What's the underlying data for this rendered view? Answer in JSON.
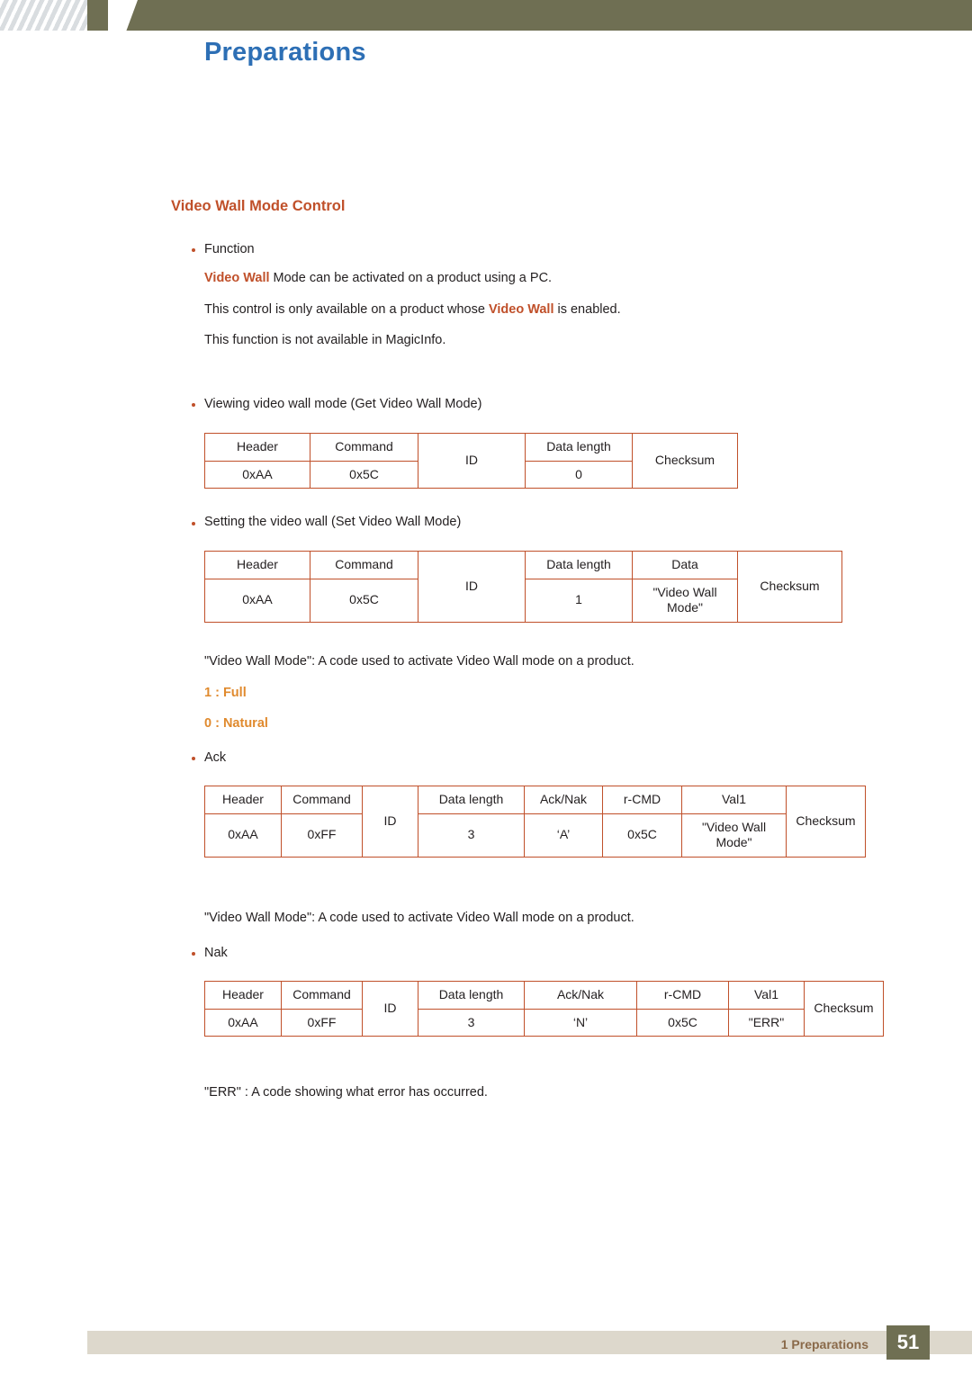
{
  "header": {
    "title": "Preparations"
  },
  "section": {
    "heading": "Video Wall Mode Control"
  },
  "blocks": {
    "function_label": "Function",
    "function_line1_a": "Video Wall",
    "function_line1_b": " Mode can be activated on a product using a PC.",
    "function_line2_a": "This control is only available on a product whose ",
    "function_line2_b": "Video Wall",
    "function_line2_c": " is enabled.",
    "function_line3": "This function is not available in MagicInfo.",
    "viewing_label": "Viewing video wall mode (Get Video Wall Mode)",
    "setting_label": "Setting the video wall (Set Video Wall Mode)",
    "note_videowall_1": "\"Video Wall Mode\": A code used to activate Video Wall mode on a product.",
    "code_full": "1 : Full",
    "code_natural": "0 : Natural",
    "ack_label": "Ack",
    "note_videowall_2": "\"Video Wall Mode\": A code used to activate Video Wall mode on a product.",
    "nak_label": "Nak",
    "note_err": "\"ERR\" : A code showing what error has occurred."
  },
  "tables": {
    "get_video_wall_mode": {
      "headers": [
        "Header",
        "Command",
        "ID",
        "Data length",
        "Checksum"
      ],
      "values": [
        "0xAA",
        "0x5C",
        "",
        "0",
        ""
      ]
    },
    "set_video_wall_mode": {
      "headers": [
        "Header",
        "Command",
        "ID",
        "Data length",
        "Data",
        "Checksum"
      ],
      "values": [
        "0xAA",
        "0x5C",
        "",
        "1",
        "\"Video Wall Mode\"",
        ""
      ]
    },
    "ack": {
      "headers": [
        "Header",
        "Command",
        "ID",
        "Data length",
        "Ack/Nak",
        "r-CMD",
        "Val1",
        "Checksum"
      ],
      "values": [
        "0xAA",
        "0xFF",
        "",
        "3",
        "‘A’",
        "0x5C",
        "\"Video Wall Mode\"",
        ""
      ]
    },
    "nak": {
      "headers": [
        "Header",
        "Command",
        "ID",
        "Data length",
        "Ack/Nak",
        "r-CMD",
        "Val1",
        "Checksum"
      ],
      "values": [
        "0xAA",
        "0xFF",
        "",
        "3",
        "‘N’",
        "0x5C",
        "\"ERR\"",
        ""
      ]
    }
  },
  "footer": {
    "label": "1 Preparations",
    "page": "51"
  }
}
